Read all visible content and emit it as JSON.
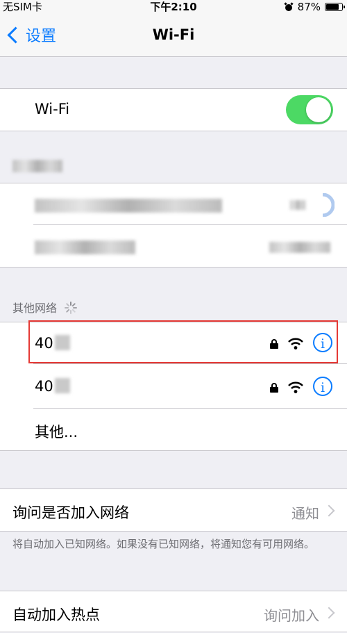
{
  "status_bar": {
    "carrier": "无SIM卡",
    "time": "下午2:10",
    "battery": "87%",
    "battery_level": 0.87
  },
  "nav": {
    "back_label": "设置",
    "title": "Wi-Fi"
  },
  "wifi_toggle": {
    "label": "Wi-Fi",
    "on": true
  },
  "other_networks": {
    "header": "其他网络",
    "networks": [
      {
        "name": "40"
      },
      {
        "name": "40"
      }
    ],
    "other_label": "其他..."
  },
  "ask_join": {
    "label": "询问是否加入网络",
    "value": "通知",
    "description": "将自动加入已知网络。如果没有已知网络，将通知您有可用网络。"
  },
  "auto_hotspot": {
    "label": "自动加入热点",
    "value": "询问加入"
  },
  "colors": {
    "accent": "#0b7cff",
    "toggle_on": "#4cd964",
    "highlight": "#e53935"
  }
}
